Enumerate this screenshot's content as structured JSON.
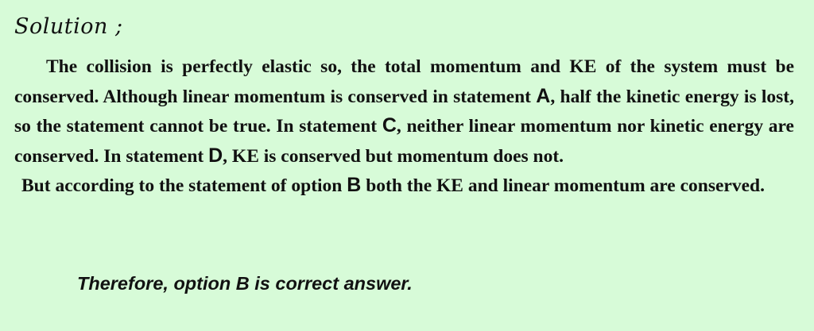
{
  "heading": "Solution ;",
  "paragraph1": {
    "t1": "The collision is perfectly elastic so, the total momentum and KE of the system must be conserved. Although linear momentum is conserved in statement ",
    "optA": "A",
    "t2": ", half the kinetic energy is lost, so the statement cannot be true. In statement ",
    "optC": "C",
    "t3": ", neither linear momentum nor kinetic energy are conserved. In statement ",
    "optD": "D",
    "t4": ", KE is conserved but momentum does not."
  },
  "paragraph2": {
    "t1": "But according to the statement of option ",
    "optB": "B",
    "t2": " both the KE and linear momentum are conserved."
  },
  "conclusion": "Therefore, option B is correct answer."
}
